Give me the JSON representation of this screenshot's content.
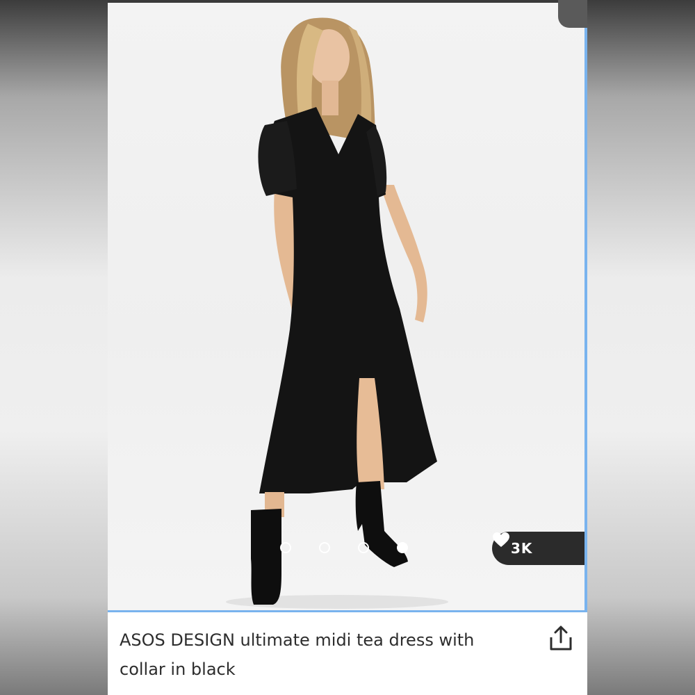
{
  "listing": {
    "title_line1": "ASOS DESIGN ultimate midi tea dress with",
    "title_line2": "collar in black",
    "likes": "3K",
    "carousel": {
      "count": 4,
      "active_index": 3
    }
  },
  "icons": {
    "like": "heart-icon",
    "share": "share-icon"
  },
  "colors": {
    "accent_border": "#79b3ee",
    "pill_background": "#2b2b2b",
    "text": "#2d2d2d"
  }
}
